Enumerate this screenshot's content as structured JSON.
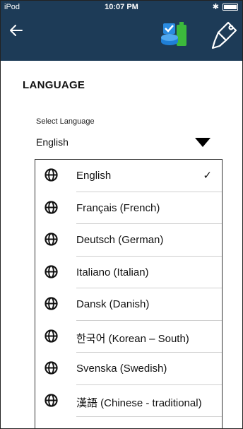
{
  "status_bar": {
    "carrier": "iPod",
    "time": "10:07 PM"
  },
  "header": {
    "background": "#1d3b57",
    "back_icon": "arrow-left-icon",
    "logo_icon": "battery-logo-icon",
    "probe_icon": "probe-icon"
  },
  "language_page": {
    "title": "LANGUAGE",
    "select_label": "Select Language",
    "selected_value": "English",
    "options": [
      {
        "label": "English",
        "selected": true
      },
      {
        "label": "Français (French)",
        "selected": false
      },
      {
        "label": "Deutsch (German)",
        "selected": false
      },
      {
        "label": "Italiano (Italian)",
        "selected": false
      },
      {
        "label": "Dansk (Danish)",
        "selected": false
      },
      {
        "label": "한국어 (Korean – South)",
        "selected": false
      },
      {
        "label": "Svenska (Swedish)",
        "selected": false
      },
      {
        "label": "漢語 (Chinese - traditional)",
        "selected": false
      }
    ],
    "check_mark": "✓"
  }
}
